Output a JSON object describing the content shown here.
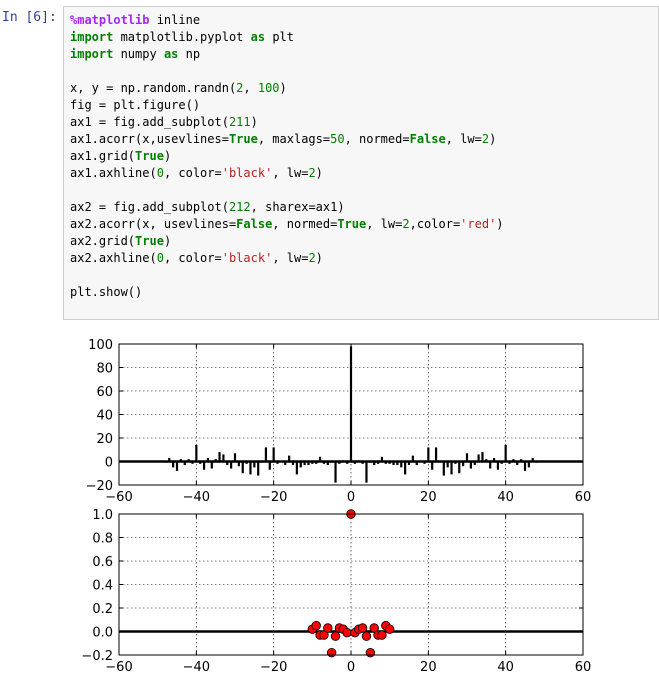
{
  "prompt": {
    "label": "In",
    "number": "[6]:"
  },
  "code_lines": [
    [
      {
        "t": "%matplotlib",
        "c": "mag"
      },
      {
        "t": " inline",
        "c": ""
      }
    ],
    [
      {
        "t": "import",
        "c": "kw"
      },
      {
        "t": " matplotlib.pyplot ",
        "c": ""
      },
      {
        "t": "as",
        "c": "kw"
      },
      {
        "t": " plt",
        "c": ""
      }
    ],
    [
      {
        "t": "import",
        "c": "kw"
      },
      {
        "t": " numpy ",
        "c": ""
      },
      {
        "t": "as",
        "c": "kw"
      },
      {
        "t": " np",
        "c": ""
      }
    ],
    [],
    [
      {
        "t": "x, y = np.random.randn(",
        "c": ""
      },
      {
        "t": "2",
        "c": "numc"
      },
      {
        "t": ", ",
        "c": ""
      },
      {
        "t": "100",
        "c": "numc"
      },
      {
        "t": ")",
        "c": ""
      }
    ],
    [
      {
        "t": "fig = plt.figure()",
        "c": ""
      }
    ],
    [
      {
        "t": "ax1 = fig.add_subplot(",
        "c": ""
      },
      {
        "t": "211",
        "c": "numc"
      },
      {
        "t": ")",
        "c": ""
      }
    ],
    [
      {
        "t": "ax1.acorr(x,usevlines=",
        "c": ""
      },
      {
        "t": "True",
        "c": "kw"
      },
      {
        "t": ", maxlags=",
        "c": ""
      },
      {
        "t": "50",
        "c": "numc"
      },
      {
        "t": ", normed=",
        "c": ""
      },
      {
        "t": "False",
        "c": "kw"
      },
      {
        "t": ", lw=",
        "c": ""
      },
      {
        "t": "2",
        "c": "numc"
      },
      {
        "t": ")",
        "c": ""
      }
    ],
    [
      {
        "t": "ax1.grid(",
        "c": ""
      },
      {
        "t": "True",
        "c": "kw"
      },
      {
        "t": ")",
        "c": ""
      }
    ],
    [
      {
        "t": "ax1.axhline(",
        "c": ""
      },
      {
        "t": "0",
        "c": "numc"
      },
      {
        "t": ", color=",
        "c": ""
      },
      {
        "t": "'black'",
        "c": "str"
      },
      {
        "t": ", lw=",
        "c": ""
      },
      {
        "t": "2",
        "c": "numc"
      },
      {
        "t": ")",
        "c": ""
      }
    ],
    [],
    [
      {
        "t": "ax2 = fig.add_subplot(",
        "c": ""
      },
      {
        "t": "212",
        "c": "numc"
      },
      {
        "t": ", sharex=ax1)",
        "c": ""
      }
    ],
    [
      {
        "t": "ax2.acorr(x, usevlines=",
        "c": ""
      },
      {
        "t": "False",
        "c": "kw"
      },
      {
        "t": ", normed=",
        "c": ""
      },
      {
        "t": "True",
        "c": "kw"
      },
      {
        "t": ", lw=",
        "c": ""
      },
      {
        "t": "2",
        "c": "numc"
      },
      {
        "t": ",color=",
        "c": ""
      },
      {
        "t": "'red'",
        "c": "str"
      },
      {
        "t": ")",
        "c": ""
      }
    ],
    [
      {
        "t": "ax2.grid(",
        "c": ""
      },
      {
        "t": "True",
        "c": "kw"
      },
      {
        "t": ")",
        "c": ""
      }
    ],
    [
      {
        "t": "ax2.axhline(",
        "c": ""
      },
      {
        "t": "0",
        "c": "numc"
      },
      {
        "t": ", color=",
        "c": ""
      },
      {
        "t": "'black'",
        "c": "str"
      },
      {
        "t": ", lw=",
        "c": ""
      },
      {
        "t": "2",
        "c": "numc"
      },
      {
        "t": ")",
        "c": ""
      }
    ],
    [],
    [
      {
        "t": "plt.show()",
        "c": ""
      }
    ]
  ],
  "chart_data": [
    {
      "type": "bar",
      "xlim": [
        -60,
        60
      ],
      "ylim": [
        -20,
        100
      ],
      "xticks": [
        -60,
        -40,
        -20,
        0,
        20,
        40,
        60
      ],
      "yticks": [
        -20,
        0,
        20,
        40,
        60,
        80,
        100
      ],
      "xtick_labels": [
        "−60",
        "−40",
        "−20",
        "0",
        "20",
        "40",
        "60"
      ],
      "ytick_labels": [
        "−20",
        "0",
        "20",
        "40",
        "60",
        "80",
        "100"
      ],
      "grid": true,
      "color": "#000000",
      "lags": [
        -48,
        -47,
        -46,
        -45,
        -44,
        -43,
        -42,
        -41,
        -40,
        -39,
        -38,
        -37,
        -36,
        -35,
        -34,
        -33,
        -32,
        -31,
        -30,
        -29,
        -28,
        -27,
        -26,
        -25,
        -24,
        -23,
        -22,
        -21,
        -20,
        -19,
        -18,
        -17,
        -16,
        -15,
        -14,
        -13,
        -12,
        -11,
        -10,
        -9,
        -8,
        -7,
        -6,
        -5,
        -4,
        -3,
        -2,
        -1,
        0,
        1,
        2,
        3,
        4,
        5,
        6,
        7,
        8,
        9,
        10,
        11,
        12,
        13,
        14,
        15,
        16,
        17,
        18,
        19,
        20,
        21,
        22,
        23,
        24,
        25,
        26,
        27,
        28,
        29,
        30,
        31,
        32,
        33,
        34,
        35,
        36,
        37,
        38,
        39,
        40,
        41,
        42,
        43,
        44,
        45,
        46,
        47,
        48
      ],
      "values": [
        -1,
        3,
        -5,
        -8,
        2,
        -3,
        2,
        -2,
        14,
        -2,
        -7,
        3,
        -6,
        2,
        8,
        6,
        -3,
        -6,
        7,
        -4,
        -10,
        -2,
        -11,
        -5,
        -12,
        -1,
        12,
        -7,
        12,
        -2,
        0,
        -3,
        5,
        -3,
        -11,
        -5,
        -3,
        -3,
        -2,
        -2,
        4,
        -2,
        -3,
        -1,
        -18,
        -2,
        1,
        -2,
        98,
        -2,
        1,
        -2,
        -18,
        -1,
        -3,
        -2,
        4,
        -2,
        -2,
        -3,
        -3,
        -5,
        -11,
        -3,
        5,
        -3,
        0,
        -2,
        12,
        -7,
        12,
        -1,
        -12,
        -5,
        -11,
        -2,
        -10,
        -4,
        7,
        -6,
        -3,
        6,
        8,
        2,
        -6,
        3,
        -7,
        -2,
        14,
        -2,
        2,
        -3,
        2,
        -8,
        -5,
        3,
        -1
      ]
    },
    {
      "type": "scatter",
      "xlim": [
        -60,
        60
      ],
      "ylim": [
        -0.2,
        1.0
      ],
      "xticks": [
        -60,
        -40,
        -20,
        0,
        20,
        40,
        60
      ],
      "yticks": [
        -0.2,
        0.0,
        0.2,
        0.4,
        0.6,
        0.8,
        1.0
      ],
      "xtick_labels": [
        "−60",
        "−40",
        "−20",
        "0",
        "20",
        "40",
        "60"
      ],
      "ytick_labels": [
        "−0.2",
        "0.0",
        "0.2",
        "0.4",
        "0.6",
        "0.8",
        "1.0"
      ],
      "grid": true,
      "color": "#ff0000",
      "x": [
        -10,
        -9,
        -8,
        -7,
        -6,
        -5,
        -4,
        -3,
        -2,
        -1,
        0,
        1,
        2,
        3,
        4,
        5,
        6,
        7,
        8,
        9,
        10
      ],
      "y": [
        0.02,
        0.05,
        -0.03,
        -0.03,
        0.03,
        -0.18,
        -0.04,
        0.03,
        0.02,
        -0.01,
        1.0,
        -0.01,
        0.02,
        0.03,
        -0.04,
        -0.18,
        0.03,
        -0.03,
        -0.03,
        0.05,
        0.02
      ]
    }
  ]
}
